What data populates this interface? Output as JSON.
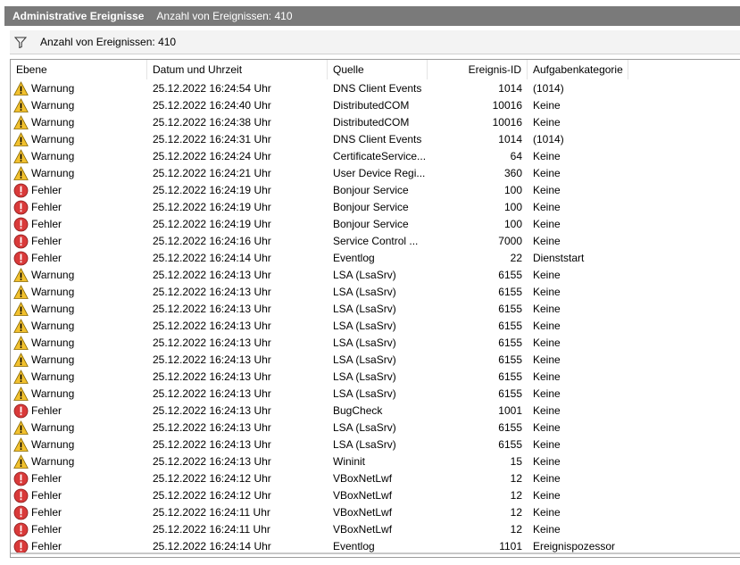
{
  "title": {
    "name": "Administrative Ereignisse",
    "count_text": "Anzahl von Ereignissen: 410"
  },
  "filterbar": {
    "count_text": "Anzahl von Ereignissen: 410",
    "icon": "filter-icon"
  },
  "columns": {
    "ebene": "Ebene",
    "datum": "Datum und Uhrzeit",
    "quelle": "Quelle",
    "id": "Ereignis-ID",
    "kategorie": "Aufgabenkategorie"
  },
  "icons": {
    "warning": "warning-icon",
    "error": "error-icon"
  },
  "colors": {
    "warning": "#f2c12e",
    "error": "#d93a3a",
    "titlebar": "#7a7a7a"
  },
  "rows": [
    {
      "level": "warning",
      "ebene": "Warnung",
      "datum": "25.12.2022 16:24:54 Uhr",
      "quelle": "DNS Client Events",
      "id": "1014",
      "kategorie": "(1014)"
    },
    {
      "level": "warning",
      "ebene": "Warnung",
      "datum": "25.12.2022 16:24:40 Uhr",
      "quelle": "DistributedCOM",
      "id": "10016",
      "kategorie": "Keine"
    },
    {
      "level": "warning",
      "ebene": "Warnung",
      "datum": "25.12.2022 16:24:38 Uhr",
      "quelle": "DistributedCOM",
      "id": "10016",
      "kategorie": "Keine"
    },
    {
      "level": "warning",
      "ebene": "Warnung",
      "datum": "25.12.2022 16:24:31 Uhr",
      "quelle": "DNS Client Events",
      "id": "1014",
      "kategorie": "(1014)"
    },
    {
      "level": "warning",
      "ebene": "Warnung",
      "datum": "25.12.2022 16:24:24 Uhr",
      "quelle": "CertificateService...",
      "id": "64",
      "kategorie": "Keine"
    },
    {
      "level": "warning",
      "ebene": "Warnung",
      "datum": "25.12.2022 16:24:21 Uhr",
      "quelle": "User Device Regi...",
      "id": "360",
      "kategorie": "Keine"
    },
    {
      "level": "error",
      "ebene": "Fehler",
      "datum": "25.12.2022 16:24:19 Uhr",
      "quelle": "Bonjour Service",
      "id": "100",
      "kategorie": "Keine"
    },
    {
      "level": "error",
      "ebene": "Fehler",
      "datum": "25.12.2022 16:24:19 Uhr",
      "quelle": "Bonjour Service",
      "id": "100",
      "kategorie": "Keine"
    },
    {
      "level": "error",
      "ebene": "Fehler",
      "datum": "25.12.2022 16:24:19 Uhr",
      "quelle": "Bonjour Service",
      "id": "100",
      "kategorie": "Keine"
    },
    {
      "level": "error",
      "ebene": "Fehler",
      "datum": "25.12.2022 16:24:16 Uhr",
      "quelle": "Service Control ...",
      "id": "7000",
      "kategorie": "Keine"
    },
    {
      "level": "error",
      "ebene": "Fehler",
      "datum": "25.12.2022 16:24:14 Uhr",
      "quelle": "Eventlog",
      "id": "22",
      "kategorie": "Dienststart"
    },
    {
      "level": "warning",
      "ebene": "Warnung",
      "datum": "25.12.2022 16:24:13 Uhr",
      "quelle": "LSA (LsaSrv)",
      "id": "6155",
      "kategorie": "Keine"
    },
    {
      "level": "warning",
      "ebene": "Warnung",
      "datum": "25.12.2022 16:24:13 Uhr",
      "quelle": "LSA (LsaSrv)",
      "id": "6155",
      "kategorie": "Keine"
    },
    {
      "level": "warning",
      "ebene": "Warnung",
      "datum": "25.12.2022 16:24:13 Uhr",
      "quelle": "LSA (LsaSrv)",
      "id": "6155",
      "kategorie": "Keine"
    },
    {
      "level": "warning",
      "ebene": "Warnung",
      "datum": "25.12.2022 16:24:13 Uhr",
      "quelle": "LSA (LsaSrv)",
      "id": "6155",
      "kategorie": "Keine"
    },
    {
      "level": "warning",
      "ebene": "Warnung",
      "datum": "25.12.2022 16:24:13 Uhr",
      "quelle": "LSA (LsaSrv)",
      "id": "6155",
      "kategorie": "Keine"
    },
    {
      "level": "warning",
      "ebene": "Warnung",
      "datum": "25.12.2022 16:24:13 Uhr",
      "quelle": "LSA (LsaSrv)",
      "id": "6155",
      "kategorie": "Keine"
    },
    {
      "level": "warning",
      "ebene": "Warnung",
      "datum": "25.12.2022 16:24:13 Uhr",
      "quelle": "LSA (LsaSrv)",
      "id": "6155",
      "kategorie": "Keine"
    },
    {
      "level": "warning",
      "ebene": "Warnung",
      "datum": "25.12.2022 16:24:13 Uhr",
      "quelle": "LSA (LsaSrv)",
      "id": "6155",
      "kategorie": "Keine"
    },
    {
      "level": "error",
      "ebene": "Fehler",
      "datum": "25.12.2022 16:24:13 Uhr",
      "quelle": "BugCheck",
      "id": "1001",
      "kategorie": "Keine"
    },
    {
      "level": "warning",
      "ebene": "Warnung",
      "datum": "25.12.2022 16:24:13 Uhr",
      "quelle": "LSA (LsaSrv)",
      "id": "6155",
      "kategorie": "Keine"
    },
    {
      "level": "warning",
      "ebene": "Warnung",
      "datum": "25.12.2022 16:24:13 Uhr",
      "quelle": "LSA (LsaSrv)",
      "id": "6155",
      "kategorie": "Keine"
    },
    {
      "level": "warning",
      "ebene": "Warnung",
      "datum": "25.12.2022 16:24:13 Uhr",
      "quelle": "Wininit",
      "id": "15",
      "kategorie": "Keine"
    },
    {
      "level": "error",
      "ebene": "Fehler",
      "datum": "25.12.2022 16:24:12 Uhr",
      "quelle": "VBoxNetLwf",
      "id": "12",
      "kategorie": "Keine"
    },
    {
      "level": "error",
      "ebene": "Fehler",
      "datum": "25.12.2022 16:24:12 Uhr",
      "quelle": "VBoxNetLwf",
      "id": "12",
      "kategorie": "Keine"
    },
    {
      "level": "error",
      "ebene": "Fehler",
      "datum": "25.12.2022 16:24:11 Uhr",
      "quelle": "VBoxNetLwf",
      "id": "12",
      "kategorie": "Keine"
    },
    {
      "level": "error",
      "ebene": "Fehler",
      "datum": "25.12.2022 16:24:11 Uhr",
      "quelle": "VBoxNetLwf",
      "id": "12",
      "kategorie": "Keine"
    },
    {
      "level": "error",
      "ebene": "Fehler",
      "datum": "25.12.2022 16:24:14 Uhr",
      "quelle": "Eventlog",
      "id": "1101",
      "kategorie": "Ereignispozessor"
    }
  ]
}
